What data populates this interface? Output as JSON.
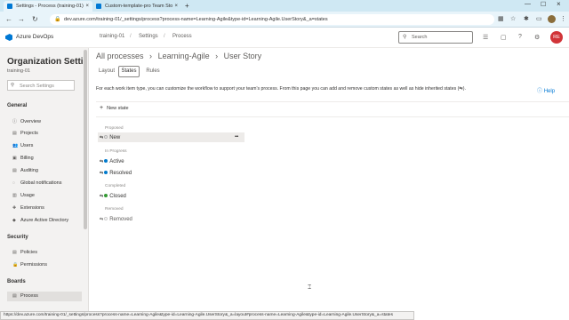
{
  "browser": {
    "tabs": [
      {
        "title": "Settings - Process (training-01)",
        "icon_color": "#0078d4"
      },
      {
        "title": "Custom-template-pro Team Sto",
        "icon_color": "#0078d4"
      }
    ],
    "url": "dev.azure.com/training-01/_settings/process?process-name=Learning-Agile&type-id=Learning-Agile.UserStory&_a=states",
    "status_url": "https://dev.azure.com/training-01/_settings/process?process-name=Learning-Agile&type-id=Learning-Agile.UserStory&_a=layout#process-name=Learning-Agile&type-id=Learning-Agile.UserStory&_a=states"
  },
  "header": {
    "product": "Azure DevOps",
    "breadcrumb": [
      "training-01",
      "Settings",
      "Process"
    ],
    "search_placeholder": "Search",
    "avatar_initials": "RE"
  },
  "sidebar": {
    "org_title": "Organization Settin...",
    "org_name": "training-01",
    "search_placeholder": "Search Settings",
    "sections": [
      {
        "title": "General",
        "items": [
          "Overview",
          "Projects",
          "Users",
          "Billing",
          "Auditing",
          "Global notifications",
          "Usage",
          "Extensions",
          "Azure Active Directory"
        ]
      },
      {
        "title": "Security",
        "items": [
          "Policies",
          "Permissions"
        ]
      },
      {
        "title": "Boards",
        "items": [
          "Process"
        ]
      }
    ]
  },
  "main": {
    "crumbs": [
      "All processes",
      "Learning-Agile",
      "User Story"
    ],
    "tabs": [
      "Layout",
      "States",
      "Rules"
    ],
    "active_tab": "States",
    "description": "For each work item type, you can customize the workflow to support your team's process. From this page you can add and remove custom states as well as hide inherited states (",
    "desc_glyph": "⇆",
    "desc_end": ").",
    "help": "Help",
    "new_state": "New state",
    "groups": [
      {
        "label": "Proposed",
        "states": [
          {
            "name": "New",
            "color": "#b2b2b2",
            "hollow": true
          }
        ]
      },
      {
        "label": "In Progress",
        "states": [
          {
            "name": "Active",
            "color": "#007acc"
          },
          {
            "name": "Resolved",
            "color": "#007acc"
          }
        ]
      },
      {
        "label": "Completed",
        "states": [
          {
            "name": "Closed",
            "color": "#339933"
          }
        ]
      },
      {
        "label": "Removed",
        "states": [
          {
            "name": "Removed",
            "color": "#cccccc",
            "hollow": true
          }
        ]
      }
    ],
    "more_glyph": "•••"
  },
  "colors": {
    "accent": "#0078d4",
    "avatar": "#d13438"
  }
}
